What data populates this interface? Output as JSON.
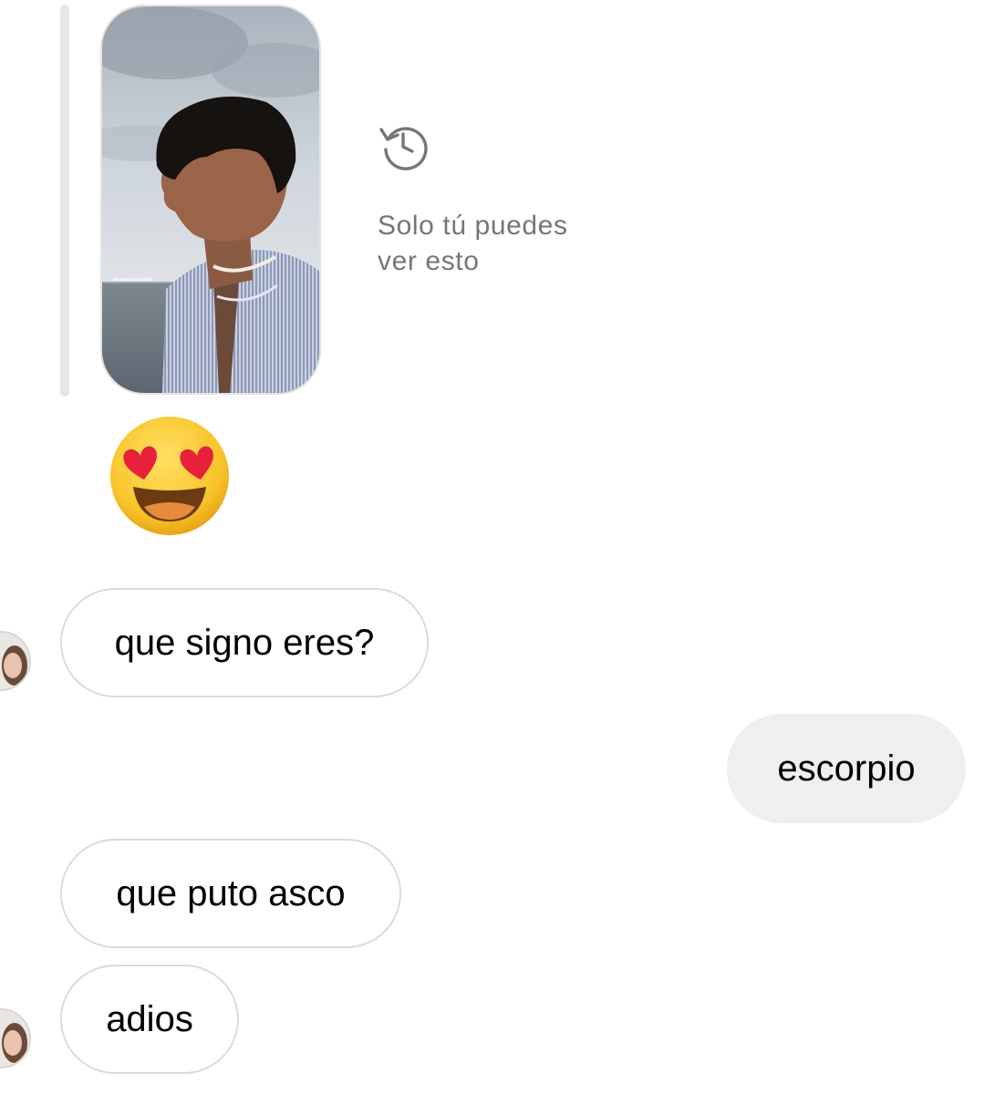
{
  "story_reply": {
    "thumbnail_caption": "me gusta mi perfil",
    "private_notice": "Solo tú puedes\nver esto",
    "notice_icon": "history-clock-icon"
  },
  "reaction_emoji": "heart-eyes-smiling-face",
  "messages": [
    {
      "sender": "other",
      "text": "que signo eres?"
    },
    {
      "sender": "me",
      "text": "escorpio"
    },
    {
      "sender": "other",
      "text": "que puto asco"
    },
    {
      "sender": "other",
      "text": "adios"
    }
  ],
  "colors": {
    "incoming_border": "#dbdbdb",
    "outgoing_bg": "#efefef",
    "muted_text": "#767676"
  }
}
